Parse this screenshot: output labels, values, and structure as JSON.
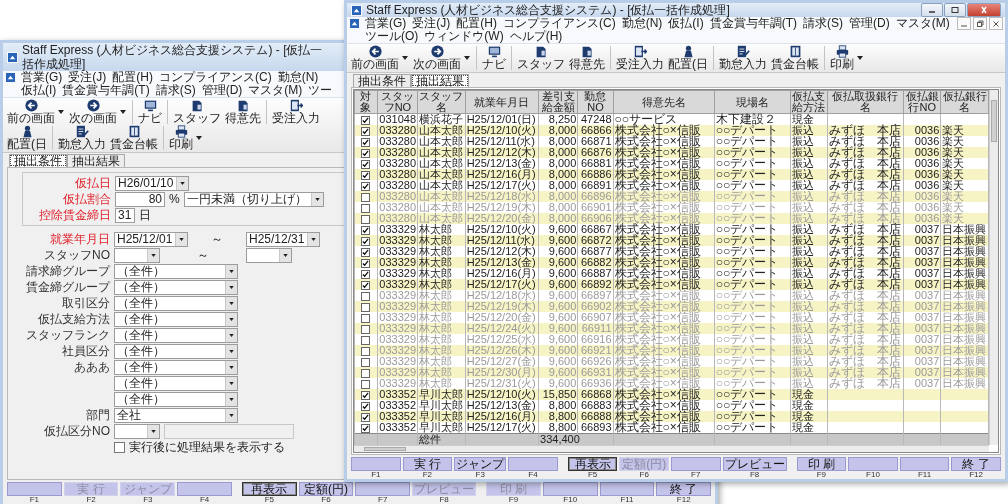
{
  "windows": [
    {
      "kind": "form",
      "title": "Staff Express (人材ビジネス総合支援システム) - [仮払一括作成処理]",
      "menu": [
        "営業(G)",
        "受注(J)",
        "配置(H)",
        "コンプライアンス(C)",
        "勤怠(N)",
        "仮払(I)",
        "賃金賞与年調(T)",
        "請求(S)",
        "管理(D)",
        "マスタ(M)",
        "ツー"
      ],
      "toolbar": [
        {
          "label": "前の画面",
          "dropdown": true
        },
        {
          "label": "次の画面",
          "dropdown": true
        },
        {
          "label": "ナビ",
          "dropdown": false
        },
        {
          "label": "スタッフ",
          "dropdown": false
        },
        {
          "label": "得意先",
          "dropdown": false
        },
        {
          "label": "受注入力",
          "dropdown": false
        },
        {
          "label": "配置(日",
          "dropdown": false
        },
        {
          "label": "勤怠入力",
          "dropdown": false
        },
        {
          "label": "賃金台帳",
          "dropdown": false
        },
        {
          "label": "印刷",
          "dropdown": true
        }
      ],
      "tabs": [
        {
          "label": "抽出条件",
          "selected": true
        },
        {
          "label": "抽出結果",
          "selected": false
        }
      ],
      "form": {
        "group": [
          {
            "kind": "date",
            "label": "仮払日",
            "required": true,
            "value": "H26/01/10"
          },
          {
            "kind": "percent",
            "label": "仮払割合",
            "required": true,
            "value": "80",
            "unit": "%",
            "option": "一円未満（切り上げ）"
          },
          {
            "kind": "day",
            "label": "控除賃金締日",
            "required": true,
            "value": "31",
            "unit": "日"
          }
        ],
        "rows": [
          {
            "kind": "range",
            "label": "就業年月日",
            "required": true,
            "from": "H25/12/01",
            "separator": "～",
            "to": "H25/12/31"
          },
          {
            "kind": "range",
            "label": "スタッフNO",
            "required": false,
            "separator": "～"
          },
          {
            "kind": "combo",
            "label": "請求締グループ",
            "required": false,
            "value": "（全件）"
          },
          {
            "kind": "combo",
            "label": "賃金締グループ",
            "required": false,
            "value": "（全件）"
          },
          {
            "kind": "combo",
            "label": "取引区分",
            "required": false,
            "value": "（全件）"
          },
          {
            "kind": "combo",
            "label": "仮払支給方法",
            "required": false,
            "value": "（全件）"
          },
          {
            "kind": "combo",
            "label": "スタッフランク",
            "required": false,
            "value": "（全件）"
          },
          {
            "kind": "combo",
            "label": "社員区分",
            "required": false,
            "value": "（全件）"
          },
          {
            "kind": "combo",
            "label": "あああ",
            "required": false,
            "value": "（全件）"
          },
          {
            "kind": "combo",
            "value": "（全件）"
          },
          {
            "kind": "combo",
            "value": "（全件）"
          },
          {
            "kind": "combo",
            "label": "部門",
            "required": false,
            "value": "全社"
          },
          {
            "kind": "combo_text",
            "label": "仮払区分NO",
            "required": false
          }
        ],
        "checkbox": {
          "label": "実行後に処理結果を表示する",
          "checked": false
        }
      },
      "function_keys": [
        {
          "key": "F1",
          "disabled": false,
          "focused": false
        },
        {
          "key": "F2",
          "label": "実 行",
          "disabled": true,
          "focused": false
        },
        {
          "key": "F3",
          "label": "ジャンプ",
          "disabled": true,
          "focused": false
        },
        {
          "key": "F4",
          "disabled": false,
          "focused": false
        },
        {
          "key": "F5",
          "label": "再表示",
          "disabled": false,
          "focused": true
        },
        {
          "key": "F6",
          "label": "定額(円)",
          "disabled": false,
          "focused": false
        },
        {
          "key": "F7",
          "disabled": false,
          "focused": false
        },
        {
          "key": "F8",
          "label": "プレビュー",
          "disabled": true,
          "focused": false
        },
        {
          "key": "F9",
          "label": "印 刷",
          "disabled": true,
          "focused": false
        },
        {
          "key": "F10",
          "disabled": false,
          "focused": false
        },
        {
          "key": "F11",
          "disabled": false,
          "focused": false
        },
        {
          "key": "F12",
          "label": "終 了",
          "disabled": false,
          "focused": false
        }
      ]
    },
    {
      "kind": "table",
      "title": "Staff Express (人材ビジネス総合支援システム) - [仮払一括作成処理]",
      "menu": [
        "営業(G)",
        "受注(J)",
        "配置(H)",
        "コンプライアンス(C)",
        "勤怠(N)",
        "仮払(I)",
        "賃金賞与年調(T)",
        "請求(S)",
        "管理(D)",
        "マスタ(M)",
        "ツール(O)",
        "ウィンドウ(W)",
        "ヘルプ(H)"
      ],
      "toolbar": [
        {
          "label": "前の画面",
          "dropdown": true
        },
        {
          "label": "次の画面",
          "dropdown": true
        },
        {
          "label": "ナビ",
          "dropdown": false
        },
        {
          "label": "スタッフ",
          "dropdown": false
        },
        {
          "label": "得意先",
          "dropdown": false
        },
        {
          "label": "受注入力",
          "dropdown": false
        },
        {
          "label": "配置(日",
          "dropdown": false
        },
        {
          "label": "勤怠入力",
          "dropdown": false
        },
        {
          "label": "賃金台帳",
          "dropdown": false
        },
        {
          "label": "印刷",
          "dropdown": true
        }
      ],
      "tabs": [
        {
          "label": "抽出条件",
          "selected": false
        },
        {
          "label": "抽出結果",
          "selected": true
        }
      ],
      "table": {
        "checkbox_column": "対象",
        "columns": [
          "スタッフNO",
          "スタッフ名",
          "就業年月日",
          "差引支給金額",
          "勤怠NO",
          "得意先名",
          "現場名",
          "仮払支給方法",
          "仮払取扱銀行名",
          "仮払銀行NO",
          "仮払銀行名"
        ],
        "rows": [
          {
            "checked": true,
            "cells": [
              "031048",
              "横浜花子",
              "H25/12/01(日)",
              "8,250",
              "47248",
              "○○サービス",
              "木下建設２",
              "現金"
            ]
          },
          {
            "checked": true,
            "cells": [
              "033280",
              "山本太郎",
              "H25/12/10(火)",
              "8,000",
              "66866",
              "株式会社○×信販",
              "○○デパート",
              "振込",
              "みずほ　本店",
              "0036",
              "楽天"
            ]
          },
          {
            "checked": true,
            "cells": [
              "033280",
              "山本太郎",
              "H25/12/11(水)",
              "8,000",
              "66871",
              "株式会社○×信販",
              "○○デパート",
              "振込",
              "みずほ　本店",
              "0036",
              "楽天"
            ]
          },
          {
            "checked": true,
            "cells": [
              "033280",
              "山本太郎",
              "H25/12/12(木)",
              "8,000",
              "66876",
              "株式会社○×信販",
              "○○デパート",
              "振込",
              "みずほ　本店",
              "0036",
              "楽天"
            ]
          },
          {
            "checked": true,
            "cells": [
              "033280",
              "山本太郎",
              "H25/12/13(金)",
              "8,000",
              "66881",
              "株式会社○×信販",
              "○○デパート",
              "振込",
              "みずほ　本店",
              "0036",
              "楽天"
            ]
          },
          {
            "checked": true,
            "cells": [
              "033280",
              "山本太郎",
              "H25/12/16(月)",
              "8,000",
              "66886",
              "株式会社○×信販",
              "○○デパート",
              "振込",
              "みずほ　本店",
              "0036",
              "楽天"
            ]
          },
          {
            "checked": true,
            "cells": [
              "033280",
              "山本太郎",
              "H25/12/17(火)",
              "8,000",
              "66891",
              "株式会社○×信販",
              "○○デパート",
              "振込",
              "みずほ　本店",
              "0036",
              "楽天"
            ]
          },
          {
            "checked": false,
            "cells": [
              "033280",
              "山本太郎",
              "H25/12/18(水)",
              "8,000",
              "66896",
              "株式会社○×信販",
              "○○デパート",
              "振込",
              "みずほ　本店",
              "0036",
              "楽天"
            ]
          },
          {
            "checked": false,
            "cells": [
              "033280",
              "山本太郎",
              "H25/12/19(木)",
              "8,000",
              "66901",
              "株式会社○×信販",
              "○○デパート",
              "振込",
              "みずほ　本店",
              "0036",
              "楽天"
            ]
          },
          {
            "checked": false,
            "cells": [
              "033280",
              "山本太郎",
              "H25/12/20(金)",
              "8,000",
              "66906",
              "株式会社○×信販",
              "○○デパート",
              "振込",
              "みずほ　本店",
              "0036",
              "楽天"
            ]
          },
          {
            "checked": true,
            "cells": [
              "033329",
              "林太郎",
              "H25/12/10(火)",
              "9,600",
              "66867",
              "株式会社○×信販",
              "○○デパート",
              "振込",
              "みずほ　本店",
              "0037",
              "日本振興"
            ]
          },
          {
            "checked": true,
            "cells": [
              "033329",
              "林太郎",
              "H25/12/11(水)",
              "9,600",
              "66872",
              "株式会社○×信販",
              "○○デパート",
              "振込",
              "みずほ　本店",
              "0037",
              "日本振興"
            ]
          },
          {
            "checked": true,
            "cells": [
              "033329",
              "林太郎",
              "H25/12/12(木)",
              "9,600",
              "66877",
              "株式会社○×信販",
              "○○デパート",
              "振込",
              "みずほ　本店",
              "0037",
              "日本振興"
            ]
          },
          {
            "checked": true,
            "cells": [
              "033329",
              "林太郎",
              "H25/12/13(金)",
              "9,600",
              "66882",
              "株式会社○×信販",
              "○○デパート",
              "振込",
              "みずほ　本店",
              "0037",
              "日本振興"
            ]
          },
          {
            "checked": true,
            "cells": [
              "033329",
              "林太郎",
              "H25/12/16(月)",
              "9,600",
              "66887",
              "株式会社○×信販",
              "○○デパート",
              "振込",
              "みずほ　本店",
              "0037",
              "日本振興"
            ]
          },
          {
            "checked": true,
            "cells": [
              "033329",
              "林太郎",
              "H25/12/17(火)",
              "9,600",
              "66892",
              "株式会社○×信販",
              "○○デパート",
              "振込",
              "みずほ　本店",
              "0037",
              "日本振興"
            ]
          },
          {
            "checked": false,
            "cells": [
              "033329",
              "林太郎",
              "H25/12/18(水)",
              "9,600",
              "66897",
              "株式会社○×信販",
              "○○デパート",
              "振込",
              "みずほ　本店",
              "0037",
              "日本振興"
            ]
          },
          {
            "checked": false,
            "cells": [
              "033329",
              "林太郎",
              "H25/12/19(木)",
              "9,600",
              "66902",
              "株式会社○×信販",
              "○○デパート",
              "振込",
              "みずほ　本店",
              "0037",
              "日本振興"
            ]
          },
          {
            "checked": false,
            "cells": [
              "033329",
              "林太郎",
              "H25/12/20(金)",
              "9,600",
              "66907",
              "株式会社○×信販",
              "○○デパート",
              "振込",
              "みずほ　本店",
              "0037",
              "日本振興"
            ]
          },
          {
            "checked": false,
            "cells": [
              "033329",
              "林太郎",
              "H25/12/24(火)",
              "9,600",
              "66911",
              "株式会社○×信販",
              "○○デパート",
              "振込",
              "みずほ　本店",
              "0037",
              "日本振興"
            ]
          },
          {
            "checked": false,
            "cells": [
              "033329",
              "林太郎",
              "H25/12/25(水)",
              "9,600",
              "66916",
              "株式会社○×信販",
              "○○デパート",
              "振込",
              "みずほ　本店",
              "0037",
              "日本振興"
            ]
          },
          {
            "checked": false,
            "cells": [
              "033329",
              "林太郎",
              "H25/12/26(木)",
              "9,600",
              "66921",
              "株式会社○×信販",
              "○○デパート",
              "振込",
              "みずほ　本店",
              "0037",
              "日本振興"
            ]
          },
          {
            "checked": false,
            "cells": [
              "033329",
              "林太郎",
              "H25/12/27(金)",
              "9,600",
              "66926",
              "株式会社○×信販",
              "○○デパート",
              "振込",
              "みずほ　本店",
              "0037",
              "日本振興"
            ]
          },
          {
            "checked": false,
            "cells": [
              "033329",
              "林太郎",
              "H25/12/30(月)",
              "9,600",
              "66931",
              "株式会社○×信販",
              "○○デパート",
              "振込",
              "みずほ　本店",
              "0037",
              "日本振興"
            ]
          },
          {
            "checked": false,
            "cells": [
              "033329",
              "林太郎",
              "H25/12/31(火)",
              "9,600",
              "66936",
              "株式会社○×信販",
              "○○デパート",
              "振込",
              "みずほ　本店",
              "0037",
              "日本振興"
            ]
          },
          {
            "checked": true,
            "cells": [
              "033352",
              "早川太郎",
              "H25/12/10(火)",
              "15,850",
              "66868",
              "株式会社○×信販",
              "○○デパート",
              "現金"
            ]
          },
          {
            "checked": true,
            "cells": [
              "033352",
              "早川太郎",
              "H25/12/13(金)",
              "8,800",
              "66883",
              "株式会社○×信販",
              "○○デパート",
              "現金"
            ]
          },
          {
            "checked": true,
            "cells": [
              "033352",
              "早川太郎",
              "H25/12/16(月)",
              "8,800",
              "66888",
              "株式会社○×信販",
              "○○デパート",
              "現金"
            ]
          },
          {
            "checked": true,
            "cells": [
              "033352",
              "早川太郎",
              "H25/12/17(火)",
              "8,800",
              "66893",
              "株式会社○×信販",
              "○○デパート",
              "現金"
            ]
          }
        ],
        "total": {
          "label": "総件",
          "amount": "334,400"
        }
      },
      "function_keys": [
        {
          "key": "F1",
          "disabled": false,
          "focused": false
        },
        {
          "key": "F2",
          "label": "実 行",
          "disabled": false,
          "focused": false
        },
        {
          "key": "F3",
          "label": "ジャンプ",
          "disabled": false,
          "focused": false
        },
        {
          "key": "F4",
          "disabled": false,
          "focused": false
        },
        {
          "key": "F5",
          "label": "再表示",
          "disabled": false,
          "focused": true
        },
        {
          "key": "F6",
          "label": "定額(円)",
          "disabled": true,
          "focused": false
        },
        {
          "key": "F7",
          "disabled": false,
          "focused": false
        },
        {
          "key": "F8",
          "label": "プレビュー",
          "disabled": false,
          "focused": false
        },
        {
          "key": "F9",
          "label": "印 刷",
          "disabled": false,
          "focused": false
        },
        {
          "key": "F10",
          "disabled": false,
          "focused": false
        },
        {
          "key": "F11",
          "disabled": false,
          "focused": false
        },
        {
          "key": "F12",
          "label": "終 了",
          "disabled": false,
          "focused": false
        }
      ]
    }
  ]
}
